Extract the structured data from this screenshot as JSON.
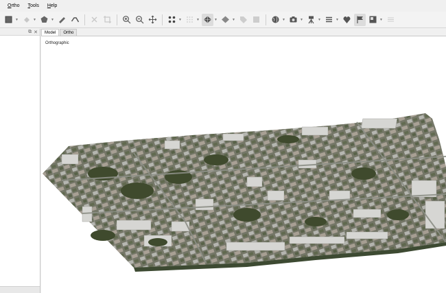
{
  "menu": {
    "items": [
      {
        "label": "Ortho",
        "underline": "O",
        "rest": "rtho"
      },
      {
        "label": "Tools",
        "underline": "T",
        "rest": "ools"
      },
      {
        "label": "Help",
        "underline": "H",
        "rest": "elp"
      }
    ]
  },
  "tabs": [
    {
      "label": "Model",
      "active": true
    },
    {
      "label": "Ortho",
      "active": false
    }
  ],
  "viewport": {
    "projection_label": "Orthographic"
  },
  "toolbar": {
    "icons": [
      "select-box-icon",
      "fill-icon",
      "polygon-icon",
      "ruler-icon",
      "polyline-icon",
      "delete-icon",
      "crop-icon",
      "zoom-in-icon",
      "zoom-out-icon",
      "move-icon",
      "points-icon",
      "grid-points-icon",
      "model-view-icon",
      "model-solid-icon",
      "tag-icon",
      "texture-icon",
      "globe-icon",
      "camera-icon",
      "tripod-icon",
      "list-icon",
      "shape-icon",
      "flag-icon",
      "ortho-view-icon",
      "more-icon"
    ]
  },
  "colors": {
    "accent": "#0078d7",
    "background": "#ffffff",
    "chrome": "#f0f0f0"
  }
}
